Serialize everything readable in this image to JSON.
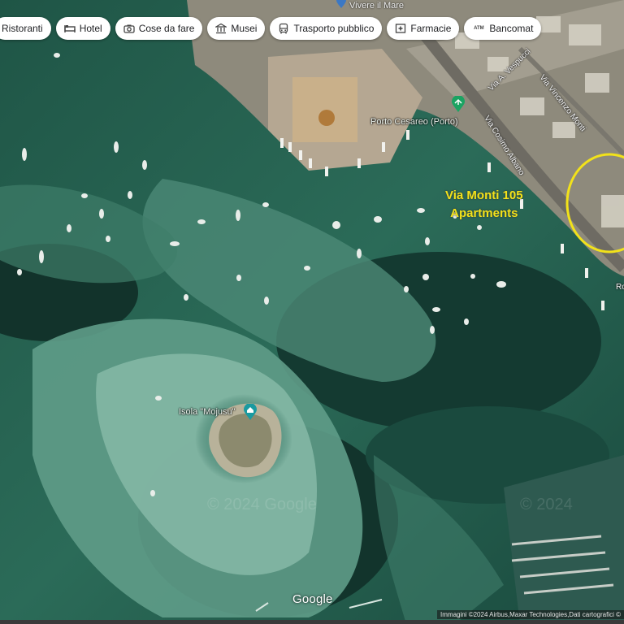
{
  "chips": [
    {
      "label": "Ristoranti",
      "icon": "restaurant-icon"
    },
    {
      "label": "Hotel",
      "icon": "hotel-bed-icon"
    },
    {
      "label": "Cose da fare",
      "icon": "camera-icon"
    },
    {
      "label": "Musei",
      "icon": "museum-icon"
    },
    {
      "label": "Trasporto pubblico",
      "icon": "bus-icon"
    },
    {
      "label": "Farmacie",
      "icon": "pharmacy-icon"
    },
    {
      "label": "Bancomat",
      "icon": "atm-icon"
    }
  ],
  "places": {
    "top_poi": "Vivere il Mare",
    "port": "Porto Cesareo (Porto)",
    "island": "Isola \"Mojusu\""
  },
  "roads": {
    "vespucci": "Via A. Vespucci",
    "monti": "Via Vincenzo Monti",
    "albano": "Via Cosimo Albano",
    "edge_label": "Ro"
  },
  "annotation": {
    "line1": "Via Monti 105",
    "line2": "Apartments",
    "color": "#f2e21a"
  },
  "watermarks": [
    "© 2024 Google",
    "© 2024"
  ],
  "footer": {
    "logo": "Google",
    "attribution": "Immagini ©2024 Airbus,Maxar Technologies,Dati cartografici ©"
  }
}
